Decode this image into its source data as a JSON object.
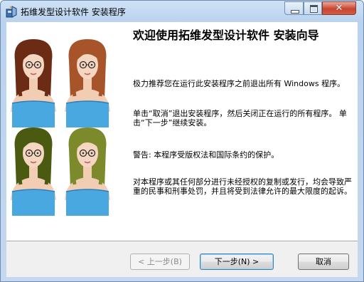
{
  "window": {
    "title": "拓维发型设计软件 安装程序",
    "controls": {
      "minimize": "minimize",
      "maximize": "maximize",
      "close": "x"
    }
  },
  "banner": {
    "image": "four-hairstyle-previews",
    "hair_colors": [
      "#6b2b14",
      "#a8542a",
      "#4a5a10",
      "#7d8a2c"
    ],
    "top_color": "#4aa8e0"
  },
  "content": {
    "heading": "欢迎使用拓维发型设计软件 安装向导",
    "paragraphs": [
      "极力推荐您在运行此安装程序之前退出所有 Windows 程序。",
      "单击“取消”退出安装程序，然后关闭正在运行的所有程序。  单击“下一步”继续安装。",
      "警告:  本程序受版权法和国际条约的保护。",
      "对本程序或其任何部分进行未经授权的复制或发行，均会导致严重的民事和刑事处罚，并且将受到法律允许的最大限度的起诉。"
    ]
  },
  "buttons": {
    "back": "< 上一步(B)",
    "next": "下一步(N) >",
    "cancel": "取消"
  }
}
